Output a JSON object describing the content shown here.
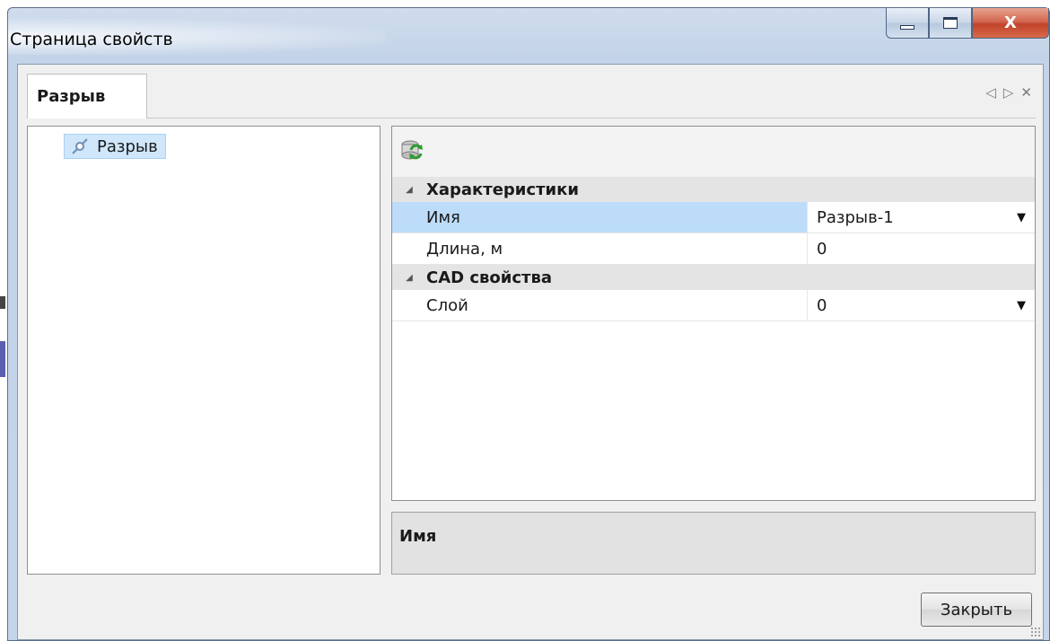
{
  "window": {
    "title": "Страница свойств",
    "close_glyph": "X"
  },
  "tabs": {
    "active": "Разрыв",
    "tools": {
      "prev": "◁",
      "next": "▷",
      "close": "✕"
    }
  },
  "tree": {
    "items": [
      {
        "label": "Разрыв",
        "icon": "break-icon",
        "selected": true
      }
    ]
  },
  "properties": {
    "categories": [
      {
        "label": "Характеристики",
        "rows": [
          {
            "name": "Имя",
            "value": "Разрыв-1",
            "dropdown": true,
            "selected": true
          },
          {
            "name": "Длина, м",
            "value": "0",
            "dropdown": false,
            "selected": false
          }
        ]
      },
      {
        "label": "CAD свойства",
        "rows": [
          {
            "name": "Слой",
            "value": "0",
            "dropdown": true,
            "selected": false
          }
        ]
      }
    ]
  },
  "description": {
    "title": "Имя"
  },
  "buttons": {
    "close": "Закрыть"
  },
  "colors": {
    "selection": "#bcdcfa",
    "tree_selection": "#cfe6fb",
    "category_bg": "#e4e4e4"
  }
}
